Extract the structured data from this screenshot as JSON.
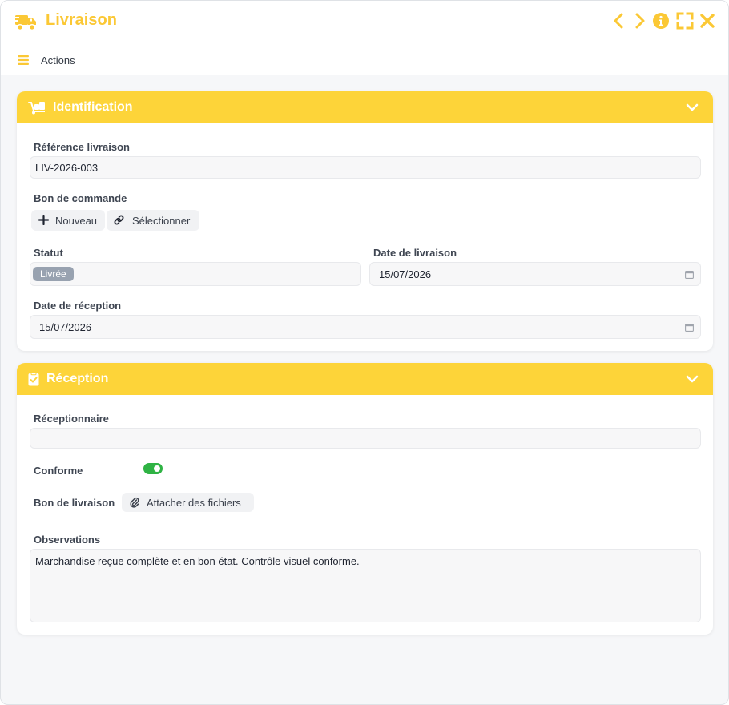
{
  "window": {
    "title": "Livraison",
    "icon": "truck-icon",
    "controls": [
      "chevron-left-icon",
      "chevron-right-icon",
      "info-icon",
      "fullscreen-icon",
      "close-icon"
    ]
  },
  "toolbar": {
    "menu_icon": "menu-icon",
    "actions_label": "Actions"
  },
  "identification": {
    "title": "Identification",
    "icon": "dolly-icon",
    "reference_label": "Référence livraison",
    "reference_value": "LIV-2026-003",
    "purchase_order_label": "Bon de commande",
    "new_label": "Nouveau",
    "select_label": "Sélectionner",
    "status_label": "Statut",
    "status_value": "Livrée",
    "delivery_date_label": "Date de livraison",
    "delivery_date_value": "15/07/2026",
    "reception_date_label": "Date de réception",
    "reception_date_value": "15/07/2026"
  },
  "reception": {
    "title": "Réception",
    "icon": "clipboard-check-icon",
    "receiver_label": "Réceptionnaire",
    "receiver_value": "",
    "compliant_label": "Conforme",
    "compliant_value": true,
    "delivery_note_label": "Bon de livraison",
    "attach_label": "Attacher des fichiers",
    "observations_label": "Observations",
    "observations_value": "Marchandise reçue complète et en bon état. Contrôle visuel conforme."
  },
  "colors": {
    "accent": "#fdd439",
    "title_text": "#fbc835",
    "badge": "#98a2b0",
    "toggle_on": "#2fb344"
  }
}
